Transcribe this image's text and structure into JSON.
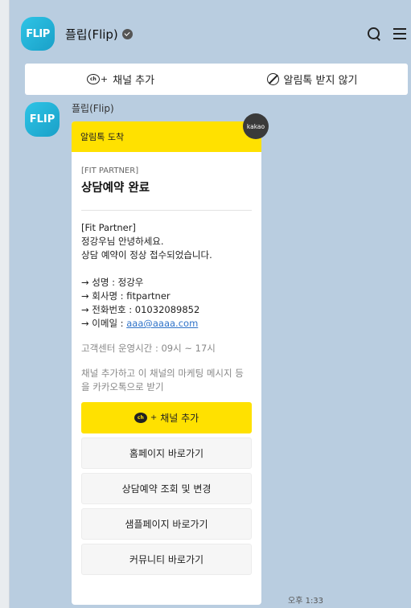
{
  "header": {
    "logo_text": "FLIP",
    "title": "플립(Flip)"
  },
  "channel_bar": {
    "add_label": "채널 추가",
    "block_label": "알림톡 받지 않기"
  },
  "message": {
    "sender_name": "플립(Flip)",
    "kakao_badge": "kakao",
    "card_header": "알림톡 도착",
    "eyebrow": "[FIT PARTNER]",
    "headline": "상담예약 완료",
    "lines_a": [
      "[Fit Partner]",
      "정강우님 안녕하세요.",
      "상담 예약이 정상 접수되었습니다."
    ],
    "lines_b": [
      "→ 성명 : 정강우",
      "→ 회사명 : fitpartner",
      "→ 전화번호 : 01032089852"
    ],
    "email_prefix": "→ 이메일 : ",
    "email": "aaa@aaaa.com",
    "hours": "고객센터 운영시간 : 09시 ~ 17시",
    "promo": "채널 추가하고 이 채널의 마케팅 메시지 등을 카카오톡으로 받기",
    "buttons": [
      "채널 추가",
      "홈페이지 바로가기",
      "상담예약 조회 및 변경",
      "샘플페이지 바로가기",
      "커뮤니티 바로가기"
    ],
    "time": "오후 1:33"
  },
  "colors": {
    "background": "#b9cde0",
    "kakao_yellow": "#ffe100",
    "brand": "#1aa0c8"
  }
}
